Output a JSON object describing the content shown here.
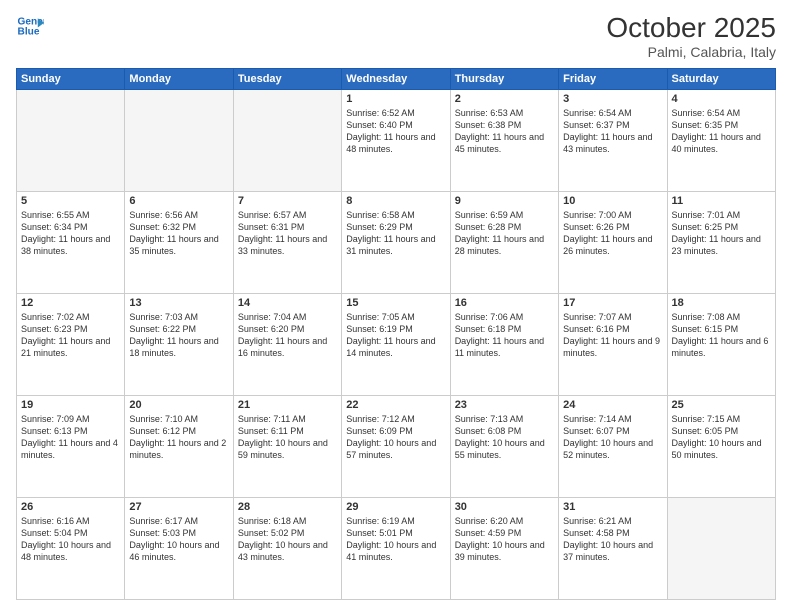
{
  "header": {
    "logo_line1": "General",
    "logo_line2": "Blue",
    "title": "October 2025",
    "subtitle": "Palmi, Calabria, Italy"
  },
  "days_of_week": [
    "Sunday",
    "Monday",
    "Tuesday",
    "Wednesday",
    "Thursday",
    "Friday",
    "Saturday"
  ],
  "weeks": [
    [
      {
        "day": "",
        "detail": ""
      },
      {
        "day": "",
        "detail": ""
      },
      {
        "day": "",
        "detail": ""
      },
      {
        "day": "1",
        "detail": "Sunrise: 6:52 AM\nSunset: 6:40 PM\nDaylight: 11 hours\nand 48 minutes."
      },
      {
        "day": "2",
        "detail": "Sunrise: 6:53 AM\nSunset: 6:38 PM\nDaylight: 11 hours\nand 45 minutes."
      },
      {
        "day": "3",
        "detail": "Sunrise: 6:54 AM\nSunset: 6:37 PM\nDaylight: 11 hours\nand 43 minutes."
      },
      {
        "day": "4",
        "detail": "Sunrise: 6:54 AM\nSunset: 6:35 PM\nDaylight: 11 hours\nand 40 minutes."
      }
    ],
    [
      {
        "day": "5",
        "detail": "Sunrise: 6:55 AM\nSunset: 6:34 PM\nDaylight: 11 hours\nand 38 minutes."
      },
      {
        "day": "6",
        "detail": "Sunrise: 6:56 AM\nSunset: 6:32 PM\nDaylight: 11 hours\nand 35 minutes."
      },
      {
        "day": "7",
        "detail": "Sunrise: 6:57 AM\nSunset: 6:31 PM\nDaylight: 11 hours\nand 33 minutes."
      },
      {
        "day": "8",
        "detail": "Sunrise: 6:58 AM\nSunset: 6:29 PM\nDaylight: 11 hours\nand 31 minutes."
      },
      {
        "day": "9",
        "detail": "Sunrise: 6:59 AM\nSunset: 6:28 PM\nDaylight: 11 hours\nand 28 minutes."
      },
      {
        "day": "10",
        "detail": "Sunrise: 7:00 AM\nSunset: 6:26 PM\nDaylight: 11 hours\nand 26 minutes."
      },
      {
        "day": "11",
        "detail": "Sunrise: 7:01 AM\nSunset: 6:25 PM\nDaylight: 11 hours\nand 23 minutes."
      }
    ],
    [
      {
        "day": "12",
        "detail": "Sunrise: 7:02 AM\nSunset: 6:23 PM\nDaylight: 11 hours\nand 21 minutes."
      },
      {
        "day": "13",
        "detail": "Sunrise: 7:03 AM\nSunset: 6:22 PM\nDaylight: 11 hours\nand 18 minutes."
      },
      {
        "day": "14",
        "detail": "Sunrise: 7:04 AM\nSunset: 6:20 PM\nDaylight: 11 hours\nand 16 minutes."
      },
      {
        "day": "15",
        "detail": "Sunrise: 7:05 AM\nSunset: 6:19 PM\nDaylight: 11 hours\nand 14 minutes."
      },
      {
        "day": "16",
        "detail": "Sunrise: 7:06 AM\nSunset: 6:18 PM\nDaylight: 11 hours\nand 11 minutes."
      },
      {
        "day": "17",
        "detail": "Sunrise: 7:07 AM\nSunset: 6:16 PM\nDaylight: 11 hours\nand 9 minutes."
      },
      {
        "day": "18",
        "detail": "Sunrise: 7:08 AM\nSunset: 6:15 PM\nDaylight: 11 hours\nand 6 minutes."
      }
    ],
    [
      {
        "day": "19",
        "detail": "Sunrise: 7:09 AM\nSunset: 6:13 PM\nDaylight: 11 hours\nand 4 minutes."
      },
      {
        "day": "20",
        "detail": "Sunrise: 7:10 AM\nSunset: 6:12 PM\nDaylight: 11 hours\nand 2 minutes."
      },
      {
        "day": "21",
        "detail": "Sunrise: 7:11 AM\nSunset: 6:11 PM\nDaylight: 10 hours\nand 59 minutes."
      },
      {
        "day": "22",
        "detail": "Sunrise: 7:12 AM\nSunset: 6:09 PM\nDaylight: 10 hours\nand 57 minutes."
      },
      {
        "day": "23",
        "detail": "Sunrise: 7:13 AM\nSunset: 6:08 PM\nDaylight: 10 hours\nand 55 minutes."
      },
      {
        "day": "24",
        "detail": "Sunrise: 7:14 AM\nSunset: 6:07 PM\nDaylight: 10 hours\nand 52 minutes."
      },
      {
        "day": "25",
        "detail": "Sunrise: 7:15 AM\nSunset: 6:05 PM\nDaylight: 10 hours\nand 50 minutes."
      }
    ],
    [
      {
        "day": "26",
        "detail": "Sunrise: 6:16 AM\nSunset: 5:04 PM\nDaylight: 10 hours\nand 48 minutes."
      },
      {
        "day": "27",
        "detail": "Sunrise: 6:17 AM\nSunset: 5:03 PM\nDaylight: 10 hours\nand 46 minutes."
      },
      {
        "day": "28",
        "detail": "Sunrise: 6:18 AM\nSunset: 5:02 PM\nDaylight: 10 hours\nand 43 minutes."
      },
      {
        "day": "29",
        "detail": "Sunrise: 6:19 AM\nSunset: 5:01 PM\nDaylight: 10 hours\nand 41 minutes."
      },
      {
        "day": "30",
        "detail": "Sunrise: 6:20 AM\nSunset: 4:59 PM\nDaylight: 10 hours\nand 39 minutes."
      },
      {
        "day": "31",
        "detail": "Sunrise: 6:21 AM\nSunset: 4:58 PM\nDaylight: 10 hours\nand 37 minutes."
      },
      {
        "day": "",
        "detail": ""
      }
    ]
  ]
}
